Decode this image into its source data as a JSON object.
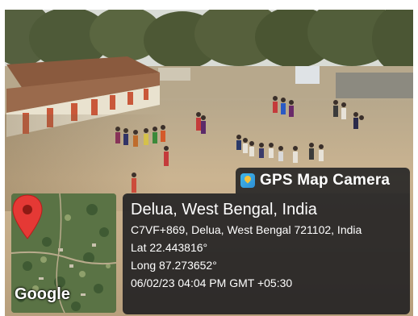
{
  "overlay": {
    "brand": "GPS Map Camera",
    "brand_icon": "gps-map-camera-icon",
    "location_title": "Delua, West Bengal, India",
    "address": "C7VF+869, Delua, West Bengal 721102, India",
    "latitude": "Lat 22.443816°",
    "longitude": "Long 87.273652°",
    "datetime": "06/02/23 04:04 PM GMT +05:30"
  },
  "map": {
    "provider_label": "Google",
    "pin_icon": "map-pin-icon",
    "pin_color": "#e53935"
  },
  "colors": {
    "panel_bg": "#14161a",
    "text": "#ffffff"
  }
}
